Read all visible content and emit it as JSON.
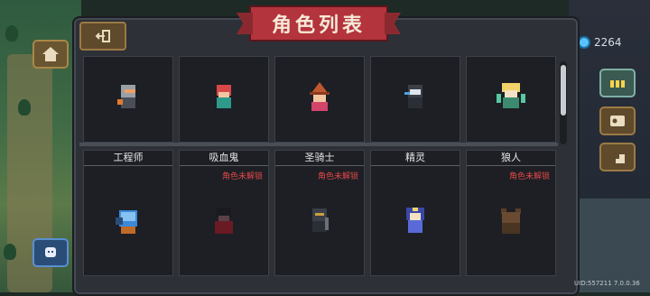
{
  "title": "角色列表",
  "currency": {
    "value": "2264",
    "color": "#5ac3ff"
  },
  "version_text": "UID:557211 7.0.0.36",
  "locked_color": "#e04848",
  "row1": [
    {
      "id": "knight",
      "icon": "knight-sprite"
    },
    {
      "id": "rogue",
      "icon": "red-hair-rogue-sprite"
    },
    {
      "id": "witch",
      "icon": "witch-hat-sprite"
    },
    {
      "id": "assassin",
      "icon": "masked-assassin-sprite"
    },
    {
      "id": "druid",
      "icon": "druid-sprite"
    }
  ],
  "row2": [
    {
      "name": "工程师",
      "locked": "",
      "icon": "engineer-sprite"
    },
    {
      "name": "吸血鬼",
      "locked": "角色未解锁",
      "icon": "vampire-sprite"
    },
    {
      "name": "圣骑士",
      "locked": "角色未解锁",
      "icon": "paladin-sprite"
    },
    {
      "name": "精灵",
      "locked": "",
      "icon": "elf-sprite"
    },
    {
      "name": "狼人",
      "locked": "角色未解锁",
      "icon": "werewolf-sprite"
    }
  ]
}
